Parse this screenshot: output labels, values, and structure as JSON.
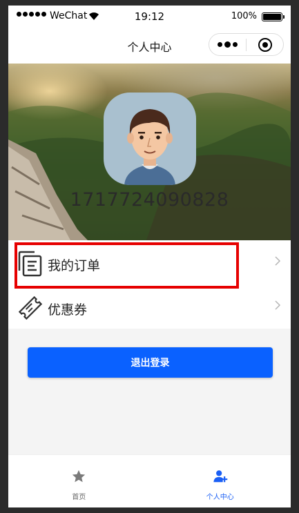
{
  "status_bar": {
    "carrier": "WeChat",
    "time": "19:12",
    "battery": "100%"
  },
  "nav": {
    "title": "个人中心"
  },
  "profile": {
    "phone": "17177240908​28"
  },
  "menu": [
    {
      "label": "我的订单",
      "icon": "orders-icon"
    },
    {
      "label": "优惠券",
      "icon": "coupon-icon"
    }
  ],
  "logout_label": "退出登录",
  "tabs": [
    {
      "label": "首页",
      "icon": "star-icon"
    },
    {
      "label": "个人中心",
      "icon": "user-add-icon"
    }
  ],
  "colors": {
    "accent": "#0a61ff",
    "active_tab": "#1a5ff5",
    "highlight": "#e60000"
  }
}
